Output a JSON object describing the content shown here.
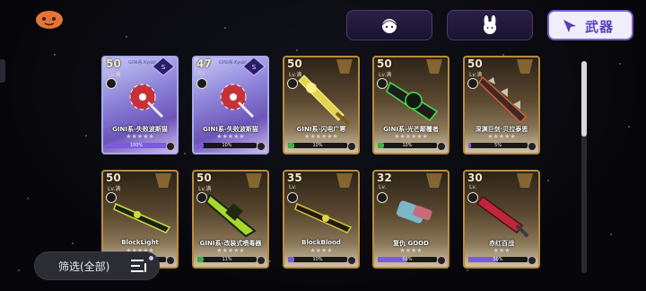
{
  "colors": {
    "accent": "#7a5cd0",
    "gold_border": "#b98b3e",
    "holo_border": "#a7a9e8",
    "bar_green": "#3fae43",
    "bar_purple": "#7b5ae0"
  },
  "tabs": [
    {
      "name": "tab-character",
      "icon": "girl-face-icon",
      "active": false,
      "label": ""
    },
    {
      "name": "tab-pet",
      "icon": "bunny-icon",
      "active": false,
      "label": ""
    },
    {
      "name": "tab-weapons",
      "icon": "spear-icon",
      "active": true,
      "label": "武器"
    }
  ],
  "scroll_position": 0.0,
  "filter": {
    "label": "筛选(全部)",
    "icon": "filter-list-icon"
  },
  "cards": [
    {
      "level": "50",
      "lvl_tag": "Lv.满",
      "name": "GINI系-失败波斯猫",
      "stars": "★★★★★",
      "progress": 100,
      "percent": "100%",
      "style": "holo",
      "bar": "bar_purple",
      "tagline": "GINI系.Kyubi"
    },
    {
      "level": "47",
      "lvl_tag": "Lv.",
      "name": "GINI系-失败波斯猫",
      "stars": "★★★★★",
      "progress": 10,
      "percent": "10%",
      "style": "holo",
      "bar": "bar_purple",
      "tagline": "GINI系.Kyubi"
    },
    {
      "level": "50",
      "lvl_tag": "Lv.满",
      "name": "GINI系-闪电广寒",
      "stars": "★★★★★★",
      "progress": 10,
      "percent": "10%",
      "style": "gold",
      "bar": "bar_green",
      "tagline": ""
    },
    {
      "level": "50",
      "lvl_tag": "Lv.满",
      "name": "GINI系-光芒颠覆者",
      "stars": "★★★★★★",
      "progress": 10,
      "percent": "10%",
      "style": "gold",
      "bar": "bar_green",
      "tagline": ""
    },
    {
      "level": "50",
      "lvl_tag": "Lv.满",
      "name": "深渊巨剑·贝拉泰恩",
      "stars": "★★★★★",
      "progress": 5,
      "percent": "5%",
      "style": "gold",
      "bar": "bar_purple",
      "tagline": ""
    },
    {
      "level": "50",
      "lvl_tag": "Lv.满",
      "name": "BlockLight",
      "stars": "★★★★★",
      "progress": 0,
      "percent": "",
      "style": "gold",
      "bar": "bar_purple",
      "tagline": ""
    },
    {
      "level": "50",
      "lvl_tag": "Lv.满",
      "name": "GINI系-改装式喷毒器",
      "stars": "★★★★★",
      "progress": 11,
      "percent": "11%",
      "style": "gold",
      "bar": "bar_green",
      "tagline": ""
    },
    {
      "level": "35",
      "lvl_tag": "Lv.",
      "name": "BlockBlood",
      "stars": "★★★★",
      "progress": 10,
      "percent": "10%",
      "style": "gold",
      "bar": "bar_purple",
      "tagline": ""
    },
    {
      "level": "32",
      "lvl_tag": "Lv.",
      "name": "复仇 GOOD",
      "stars": "★★★★",
      "progress": 50,
      "percent": "50%",
      "style": "gold",
      "bar": "bar_purple",
      "tagline": ""
    },
    {
      "level": "30",
      "lvl_tag": "Lv.",
      "name": "赤红百战",
      "stars": "★★★",
      "progress": 50,
      "percent": "50%",
      "style": "gold",
      "bar": "bar_purple",
      "tagline": ""
    }
  ]
}
